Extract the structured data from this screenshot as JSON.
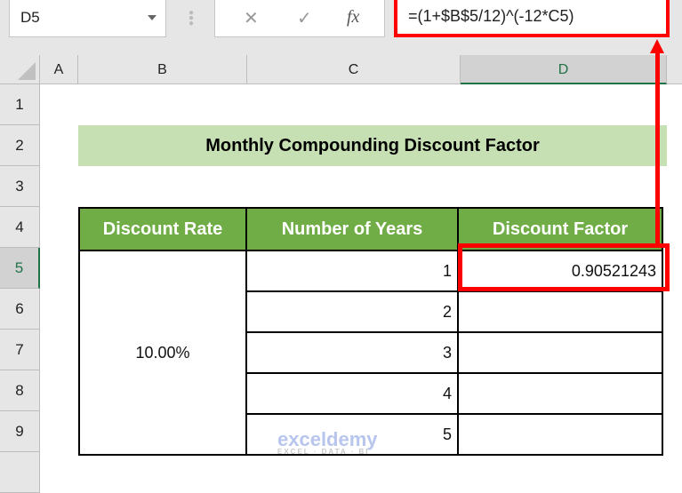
{
  "name_box": "D5",
  "formula_bar": {
    "cancel_icon": "✕",
    "enter_icon": "✓",
    "fx_icon": "fx",
    "formula": "=(1+$B$5/12)^(-12*C5)"
  },
  "columns": [
    "A",
    "B",
    "C",
    "D"
  ],
  "selected_column": "D",
  "rows": [
    "1",
    "2",
    "3",
    "4",
    "5",
    "6",
    "7",
    "8",
    "9"
  ],
  "selected_row": "5",
  "sheet": {
    "title": "Monthly Compounding Discount Factor",
    "headers": [
      "Discount Rate",
      "Number of Years",
      "Discount Factor"
    ],
    "discount_rate": "10.00%",
    "years": [
      "1",
      "2",
      "3",
      "4",
      "5"
    ],
    "factors": [
      "0.90521243",
      "",
      "",
      "",
      ""
    ]
  },
  "watermark": {
    "name": "exceldemy",
    "tagline": "EXCEL · DATA · BI"
  }
}
